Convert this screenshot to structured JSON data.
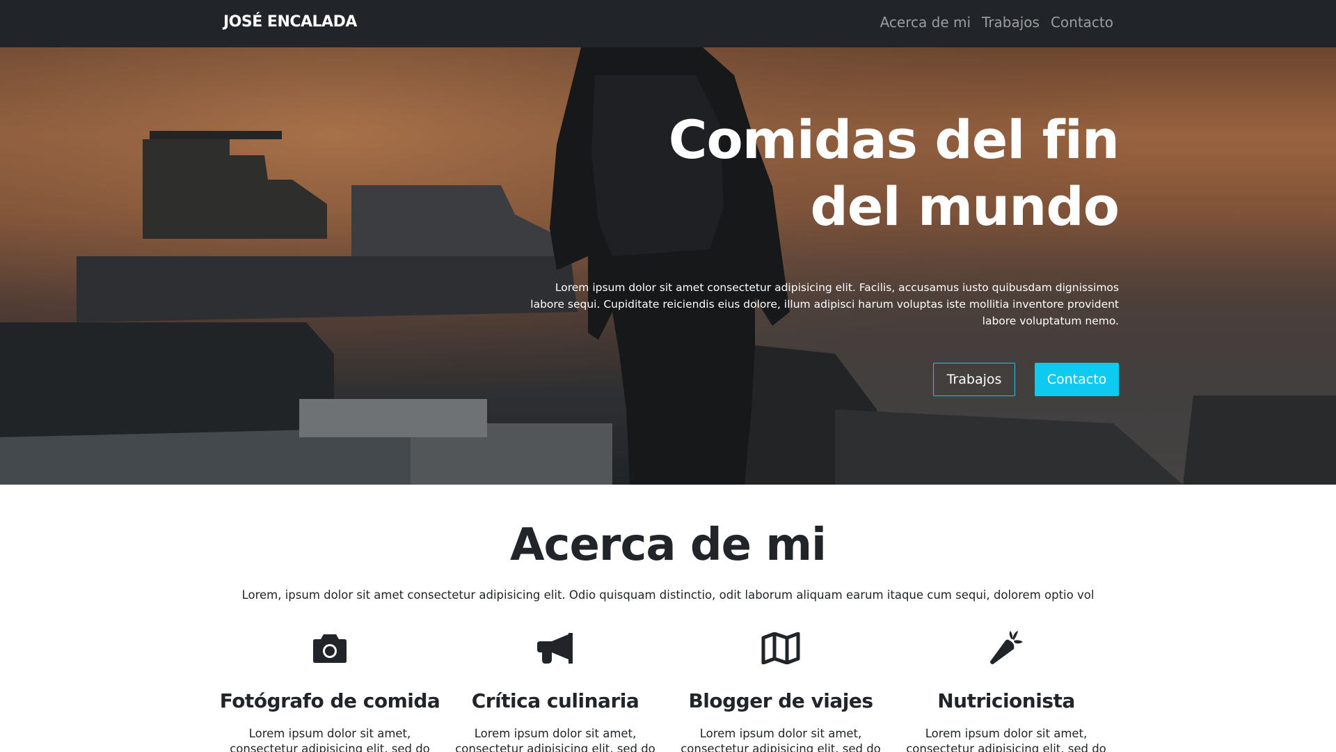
{
  "navbar": {
    "brand": "JOSÉ ENCALADA",
    "links": [
      "Acerca de mi",
      "Trabajos",
      "Contacto"
    ]
  },
  "hero": {
    "title_line1": "Comidas del fin",
    "title_line2": "del mundo",
    "text": "Lorem ipsum dolor sit amet consectetur adipisicing elit. Facilis, accusamus iusto quibusdam dignissimos labore sequi. Cupiditate reiciendis eius dolore, illum adipisci harum voluptas iste mollitia inventore provident labore voluptatum nemo.",
    "button_outline": "Trabajos",
    "button_fill": "Contacto"
  },
  "about": {
    "title": "Acerca de mi",
    "lead": "Lorem, ipsum dolor sit amet consectetur adipisicing elit. Odio quisquam distinctio, odit laborum aliquam earum itaque cum sequi, dolorem optio vol",
    "features": [
      {
        "icon": "camera-icon",
        "title": "Fotógrafo de comida",
        "text": "Lorem ipsum dolor sit amet, consectetur adipisicing elit, sed do eiusmod tempor"
      },
      {
        "icon": "megaphone-icon",
        "title": "Crítica culinaria",
        "text": "Lorem ipsum dolor sit amet, consectetur adipisicing elit, sed do eiusmod tempor"
      },
      {
        "icon": "map-icon",
        "title": "Blogger de viajes",
        "text": "Lorem ipsum dolor sit amet, consectetur adipisicing elit, sed do eiusmod tempor"
      },
      {
        "icon": "carrot-icon",
        "title": "Nutricionista",
        "text": "Lorem ipsum dolor sit amet, consectetur adipisicing elit, sed do eiusmod tempor"
      }
    ]
  },
  "colors": {
    "navbar_bg": "#212529",
    "accent": "#0dcaf0",
    "text_dark": "#212529"
  }
}
